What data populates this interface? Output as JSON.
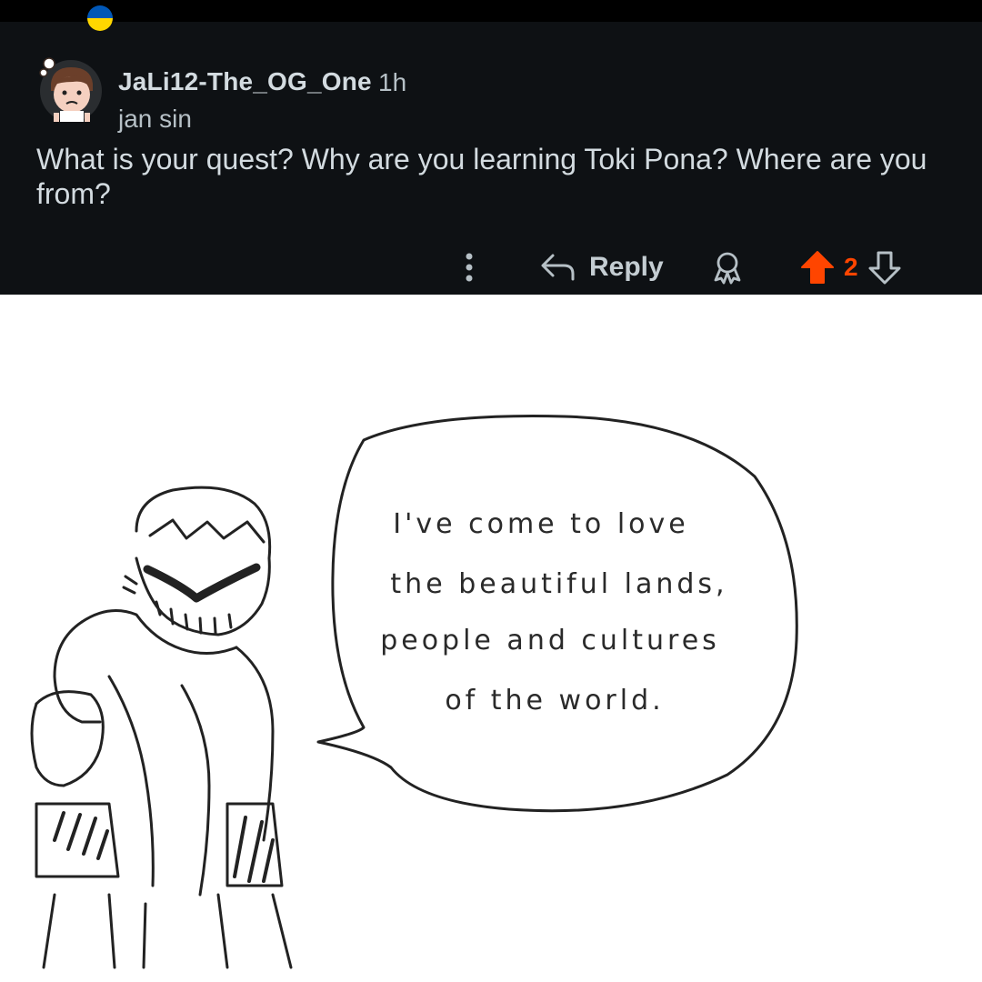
{
  "comment": {
    "username": "JaLi12-The_OG_One",
    "time": "1h",
    "flair": "jan sin",
    "text": "What is your quest? Why are you learning Toki Pona? Where are you from?",
    "actions": {
      "reply_label": "Reply",
      "score": "2"
    }
  },
  "comic": {
    "speech_lines": [
      "I've come to love",
      "the beautiful lands,",
      "people and cultures",
      "of the world."
    ]
  },
  "colors": {
    "card_bg": "#0e1114",
    "text": "#d3dbe0",
    "upvote": "#ff4500",
    "flag_blue": "#0057b7",
    "flag_yellow": "#ffd700"
  },
  "icons": [
    "ukraine-flag-icon",
    "avatar",
    "more-options-icon",
    "reply-arrow-icon",
    "award-icon",
    "upvote-icon",
    "downvote-icon"
  ]
}
